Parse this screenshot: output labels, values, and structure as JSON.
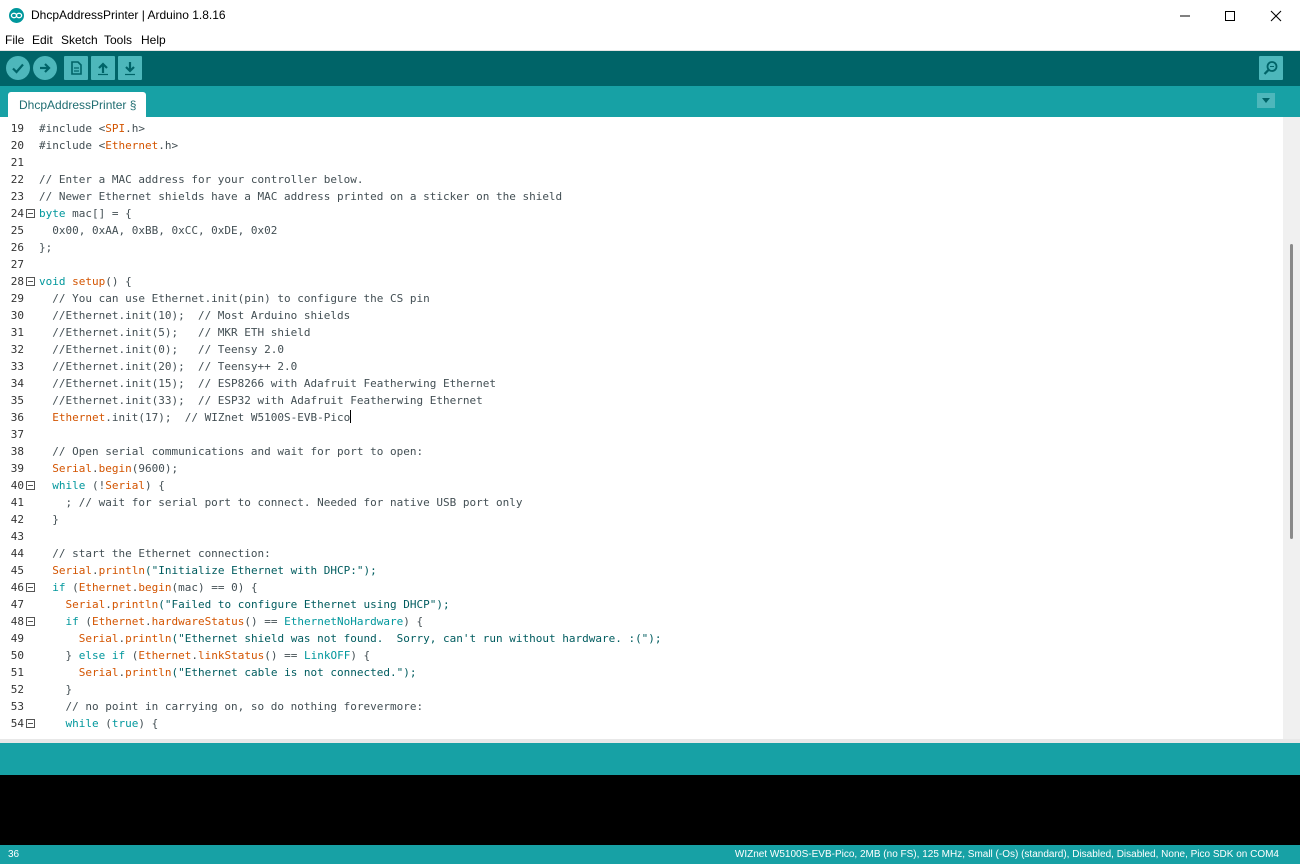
{
  "window": {
    "title": "DhcpAddressPrinter | Arduino 1.8.16",
    "app_icon": "arduino-infinity-icon",
    "minimize_icon": "minimize-icon",
    "maximize_icon": "maximize-icon",
    "close_icon": "close-icon"
  },
  "menu": [
    "File",
    "Edit",
    "Sketch",
    "Tools",
    "Help"
  ],
  "toolbar": {
    "verify_icon": "checkmark-icon",
    "upload_icon": "arrow-right-icon",
    "new_icon": "new-file-icon",
    "open_icon": "arrow-up-icon",
    "save_icon": "arrow-down-icon",
    "serial_monitor_icon": "magnifier-icon"
  },
  "tabs": [
    {
      "label": "DhcpAddressPrinter §"
    }
  ],
  "editor": {
    "lines": [
      {
        "num": "19",
        "fold": false,
        "segs": [
          [
            "cm",
            "#include <"
          ],
          [
            "fn",
            "SPI"
          ],
          [
            "cm",
            ".h>"
          ]
        ]
      },
      {
        "num": "20",
        "fold": false,
        "segs": [
          [
            "cm",
            "#include <"
          ],
          [
            "fn",
            "Ethernet"
          ],
          [
            "cm",
            ".h>"
          ]
        ]
      },
      {
        "num": "21",
        "fold": false,
        "segs": []
      },
      {
        "num": "22",
        "fold": false,
        "segs": [
          [
            "cm",
            "// Enter a MAC address for your controller below."
          ]
        ]
      },
      {
        "num": "23",
        "fold": false,
        "segs": [
          [
            "cm",
            "// Newer Ethernet shields have a MAC address printed on a sticker on the shield"
          ]
        ]
      },
      {
        "num": "24",
        "fold": true,
        "segs": [
          [
            "ty",
            "byte"
          ],
          [
            "cm",
            " mac[] = {"
          ]
        ]
      },
      {
        "num": "25",
        "fold": false,
        "segs": [
          [
            "cm",
            "  0x00, 0xAA, 0xBB, 0xCC, 0xDE, 0x02"
          ]
        ]
      },
      {
        "num": "26",
        "fold": false,
        "segs": [
          [
            "cm",
            "};"
          ]
        ]
      },
      {
        "num": "27",
        "fold": false,
        "segs": []
      },
      {
        "num": "28",
        "fold": true,
        "segs": [
          [
            "ty",
            "void"
          ],
          [
            "cm",
            " "
          ],
          [
            "fn",
            "setup"
          ],
          [
            "cm",
            "() {"
          ]
        ]
      },
      {
        "num": "29",
        "fold": false,
        "segs": [
          [
            "cm",
            "  // You can use Ethernet.init(pin) to configure the CS pin"
          ]
        ]
      },
      {
        "num": "30",
        "fold": false,
        "segs": [
          [
            "cm",
            "  //Ethernet.init(10);  // Most Arduino shields"
          ]
        ]
      },
      {
        "num": "31",
        "fold": false,
        "segs": [
          [
            "cm",
            "  //Ethernet.init(5);   // MKR ETH shield"
          ]
        ]
      },
      {
        "num": "32",
        "fold": false,
        "segs": [
          [
            "cm",
            "  //Ethernet.init(0);   // Teensy 2.0"
          ]
        ]
      },
      {
        "num": "33",
        "fold": false,
        "segs": [
          [
            "cm",
            "  //Ethernet.init(20);  // Teensy++ 2.0"
          ]
        ]
      },
      {
        "num": "34",
        "fold": false,
        "segs": [
          [
            "cm",
            "  //Ethernet.init(15);  // ESP8266 with Adafruit Featherwing Ethernet"
          ]
        ]
      },
      {
        "num": "35",
        "fold": false,
        "segs": [
          [
            "cm",
            "  //Ethernet.init(33);  // ESP32 with Adafruit Featherwing Ethernet"
          ]
        ]
      },
      {
        "num": "36",
        "fold": false,
        "caret": true,
        "segs": [
          [
            "cm",
            "  "
          ],
          [
            "fn",
            "Ethernet"
          ],
          [
            "cm",
            ".init(17);  // WIZnet W5100S-EVB-Pico"
          ]
        ]
      },
      {
        "num": "37",
        "fold": false,
        "segs": []
      },
      {
        "num": "38",
        "fold": false,
        "segs": [
          [
            "cm",
            "  // Open serial communications and wait for port to open:"
          ]
        ]
      },
      {
        "num": "39",
        "fold": false,
        "segs": [
          [
            "cm",
            "  "
          ],
          [
            "fn",
            "Serial"
          ],
          [
            "cm",
            "."
          ],
          [
            "fn",
            "begin"
          ],
          [
            "cm",
            "(9600);"
          ]
        ]
      },
      {
        "num": "40",
        "fold": true,
        "segs": [
          [
            "cm",
            "  "
          ],
          [
            "kw",
            "while"
          ],
          [
            "cm",
            " (!"
          ],
          [
            "fn",
            "Serial"
          ],
          [
            "cm",
            ") {"
          ]
        ]
      },
      {
        "num": "41",
        "fold": false,
        "segs": [
          [
            "cm",
            "    ; // wait for serial port to connect. Needed for native USB port only"
          ]
        ]
      },
      {
        "num": "42",
        "fold": false,
        "segs": [
          [
            "cm",
            "  }"
          ]
        ]
      },
      {
        "num": "43",
        "fold": false,
        "segs": []
      },
      {
        "num": "44",
        "fold": false,
        "segs": [
          [
            "cm",
            "  // start the Ethernet connection:"
          ]
        ]
      },
      {
        "num": "45",
        "fold": false,
        "segs": [
          [
            "cm",
            "  "
          ],
          [
            "fn",
            "Serial"
          ],
          [
            "cm",
            "."
          ],
          [
            "fn",
            "println"
          ],
          [
            "st",
            "(\"Initialize Ethernet with DHCP:\");"
          ]
        ]
      },
      {
        "num": "46",
        "fold": true,
        "segs": [
          [
            "cm",
            "  "
          ],
          [
            "kw",
            "if"
          ],
          [
            "cm",
            " ("
          ],
          [
            "fn",
            "Ethernet"
          ],
          [
            "cm",
            "."
          ],
          [
            "fn",
            "begin"
          ],
          [
            "cm",
            "(mac) == 0) {"
          ]
        ]
      },
      {
        "num": "47",
        "fold": false,
        "segs": [
          [
            "cm",
            "    "
          ],
          [
            "fn",
            "Serial"
          ],
          [
            "cm",
            "."
          ],
          [
            "fn",
            "println"
          ],
          [
            "st",
            "(\"Failed to configure Ethernet using DHCP\");"
          ]
        ]
      },
      {
        "num": "48",
        "fold": true,
        "segs": [
          [
            "cm",
            "    "
          ],
          [
            "kw",
            "if"
          ],
          [
            "cm",
            " ("
          ],
          [
            "fn",
            "Ethernet"
          ],
          [
            "cm",
            "."
          ],
          [
            "fn",
            "hardwareStatus"
          ],
          [
            "cm",
            "() == "
          ],
          [
            "ty",
            "EthernetNoHardware"
          ],
          [
            "cm",
            ") {"
          ]
        ]
      },
      {
        "num": "49",
        "fold": false,
        "segs": [
          [
            "cm",
            "      "
          ],
          [
            "fn",
            "Serial"
          ],
          [
            "cm",
            "."
          ],
          [
            "fn",
            "println"
          ],
          [
            "st",
            "(\"Ethernet shield was not found.  Sorry, can't run without hardware. :(\");"
          ]
        ]
      },
      {
        "num": "50",
        "fold": false,
        "segs": [
          [
            "cm",
            "    } "
          ],
          [
            "kw",
            "else if"
          ],
          [
            "cm",
            " ("
          ],
          [
            "fn",
            "Ethernet"
          ],
          [
            "cm",
            "."
          ],
          [
            "fn",
            "linkStatus"
          ],
          [
            "cm",
            "() == "
          ],
          [
            "ty",
            "LinkOFF"
          ],
          [
            "cm",
            ") {"
          ]
        ]
      },
      {
        "num": "51",
        "fold": false,
        "segs": [
          [
            "cm",
            "      "
          ],
          [
            "fn",
            "Serial"
          ],
          [
            "cm",
            "."
          ],
          [
            "fn",
            "println"
          ],
          [
            "st",
            "(\"Ethernet cable is not connected.\");"
          ]
        ]
      },
      {
        "num": "52",
        "fold": false,
        "segs": [
          [
            "cm",
            "    }"
          ]
        ]
      },
      {
        "num": "53",
        "fold": false,
        "segs": [
          [
            "cm",
            "    // no point in carrying on, so do nothing forevermore:"
          ]
        ]
      },
      {
        "num": "54",
        "fold": true,
        "segs": [
          [
            "cm",
            "    "
          ],
          [
            "kw",
            "while"
          ],
          [
            "cm",
            " ("
          ],
          [
            "ty",
            "true"
          ],
          [
            "cm",
            ") {"
          ]
        ]
      }
    ]
  },
  "status": {
    "line": "36",
    "board": "WIZnet W5100S-EVB-Pico, 2MB (no FS), 125 MHz, Small (-Os) (standard), Disabled, Disabled, None, Pico SDK on COM4"
  }
}
